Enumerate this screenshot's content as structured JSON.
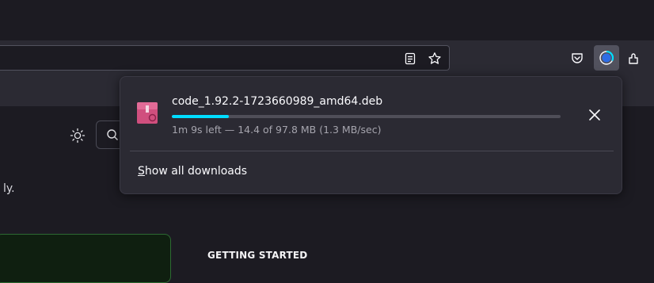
{
  "toolbar": {
    "reader_view_icon": "reader-view-icon",
    "bookmark_star_icon": "star-icon",
    "pocket_icon": "pocket-icon",
    "downloads_icon": "downloads-progress-icon",
    "extensions_icon": "extensions-icon"
  },
  "page": {
    "partial_text": "ly.",
    "getting_started": "GETTING STARTED"
  },
  "downloads_panel": {
    "item": {
      "filename": "code_1.92.2-1723660989_amd64.deb",
      "status": "1m 9s left — 14.4 of 97.8 MB (1.3 MB/sec)",
      "progress_fraction": 0.147,
      "icon": "deb-package-icon",
      "cancel_icon": "close-icon"
    },
    "show_all_accesskey": "S",
    "show_all_rest": "how all downloads"
  },
  "colors": {
    "accent": "#00ddff",
    "panel_bg": "#2b2a33",
    "toolbar_bg": "#2b2a33",
    "window_bg": "#1c1b22"
  }
}
